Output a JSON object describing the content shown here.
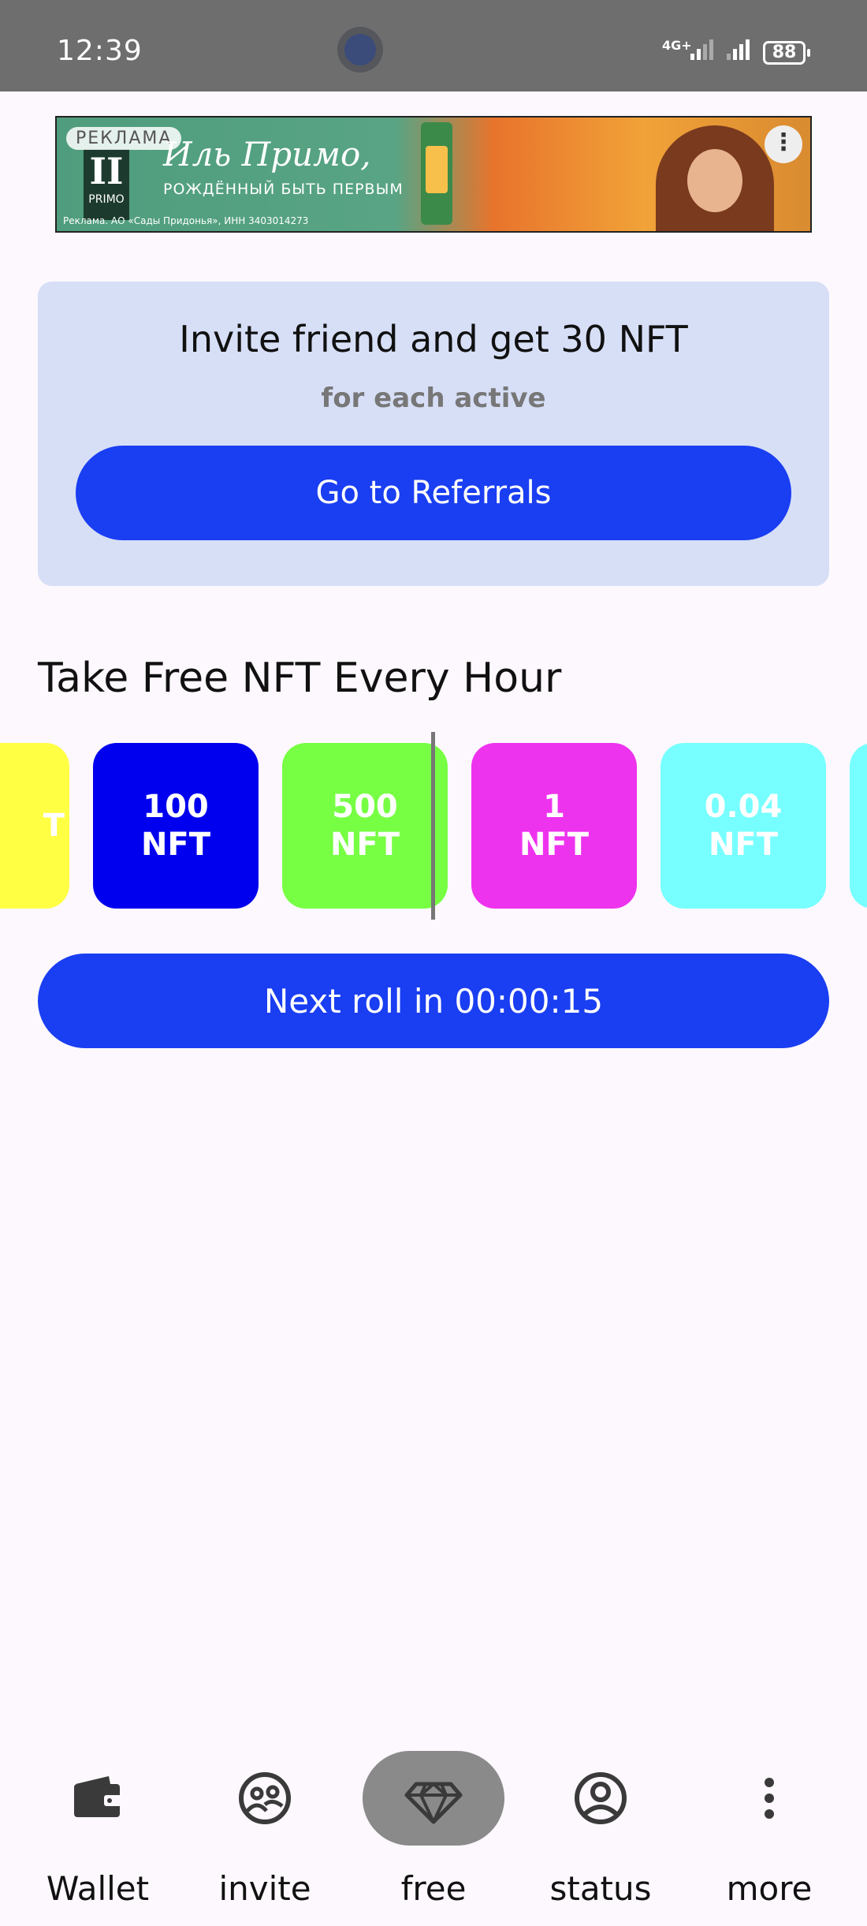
{
  "status_bar": {
    "time": "12:39",
    "network": "4G+",
    "battery": "88"
  },
  "ad": {
    "label": "РЕКЛАМА",
    "logo_text": "PRIMO",
    "headline": "Иль Примо,",
    "subline": "РОЖДЁННЫЙ БЫТЬ ПЕРВЫМ",
    "disclaimer": "Реклама. АО «Сады Придонья», ИНН 3403014273"
  },
  "invite_card": {
    "title": "Invite friend and get 30 NFT",
    "subtitle": "for each active",
    "button_label": "Go to Referrals"
  },
  "free_section": {
    "title": "Take Free NFT Every Hour",
    "tiles": [
      {
        "amount": "",
        "unit": "T",
        "color": "#ffff44"
      },
      {
        "amount": "100",
        "unit": "NFT",
        "color": "#0000ee"
      },
      {
        "amount": "500",
        "unit": "NFT",
        "color": "#77ff44"
      },
      {
        "amount": "1",
        "unit": "NFT",
        "color": "#ee33ee"
      },
      {
        "amount": "0.04",
        "unit": "NFT",
        "color": "#77ffff"
      },
      {
        "amount": "",
        "unit": "",
        "color": "#77ffff"
      }
    ],
    "roll_button_label": "Next roll in 00:00:15"
  },
  "bottom_nav": {
    "items": [
      {
        "label": "Wallet",
        "icon": "wallet-icon",
        "active": false
      },
      {
        "label": "invite",
        "icon": "people-icon",
        "active": false
      },
      {
        "label": "free",
        "icon": "diamond-icon",
        "active": true
      },
      {
        "label": "status",
        "icon": "account-circle-icon",
        "active": false
      },
      {
        "label": "more",
        "icon": "more-vertical-icon",
        "active": false
      }
    ]
  }
}
